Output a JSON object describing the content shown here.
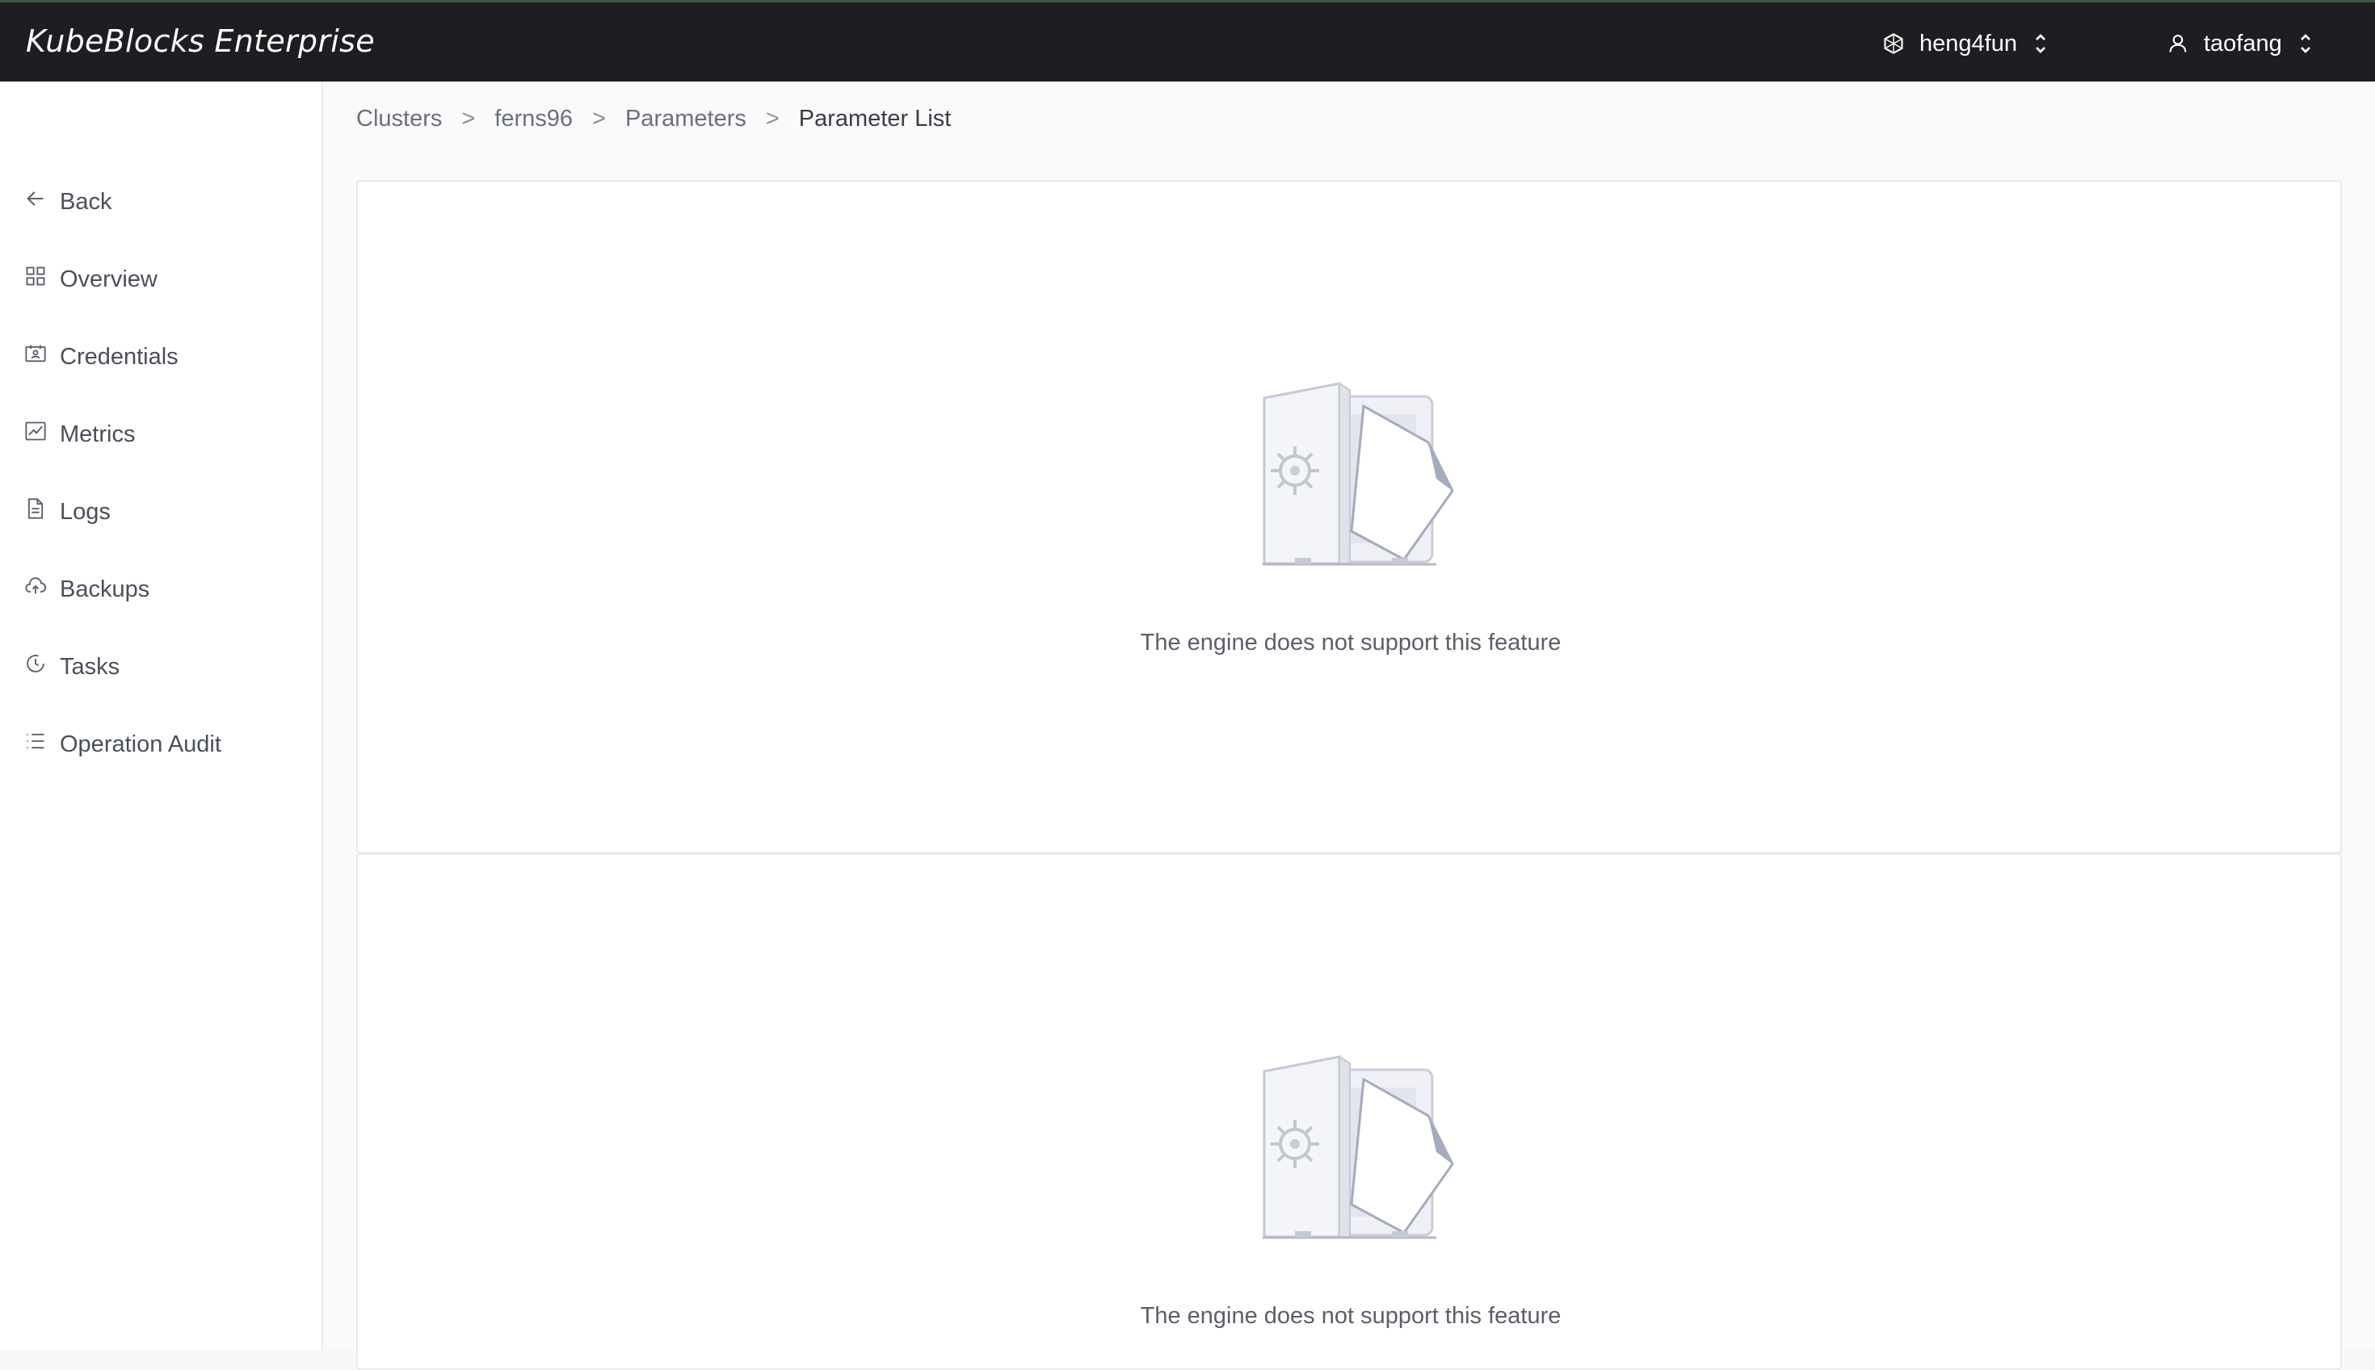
{
  "app": {
    "brand": "KubeBlocks Enterprise",
    "workspace": "heng4fun",
    "user": "taofang"
  },
  "sidebar": {
    "items": [
      {
        "label": "Back",
        "icon": "arrow-left-icon"
      },
      {
        "label": "Overview",
        "icon": "grid-icon"
      },
      {
        "label": "Credentials",
        "icon": "id-card-icon"
      },
      {
        "label": "Metrics",
        "icon": "chart-line-icon"
      },
      {
        "label": "Logs",
        "icon": "document-icon"
      },
      {
        "label": "Backups",
        "icon": "cloud-upload-icon"
      },
      {
        "label": "Tasks",
        "icon": "clock-icon"
      },
      {
        "label": "Operation Audit",
        "icon": "list-icon"
      }
    ]
  },
  "breadcrumb": {
    "items": [
      "Clusters",
      "ferns96",
      "Parameters"
    ],
    "current": "Parameter List",
    "separator": ">"
  },
  "cards": [
    {
      "empty_text": "The engine does not support this feature",
      "icon": "empty-safe-icon"
    },
    {
      "empty_text": "The engine does not support this feature",
      "icon": "empty-safe-icon"
    }
  ],
  "colors": {
    "topbar_bg": "#1d1e21",
    "topbar_accent": "#3f5a45",
    "sidebar_bg": "#ffffff",
    "main_bg": "#fafafa"
  }
}
